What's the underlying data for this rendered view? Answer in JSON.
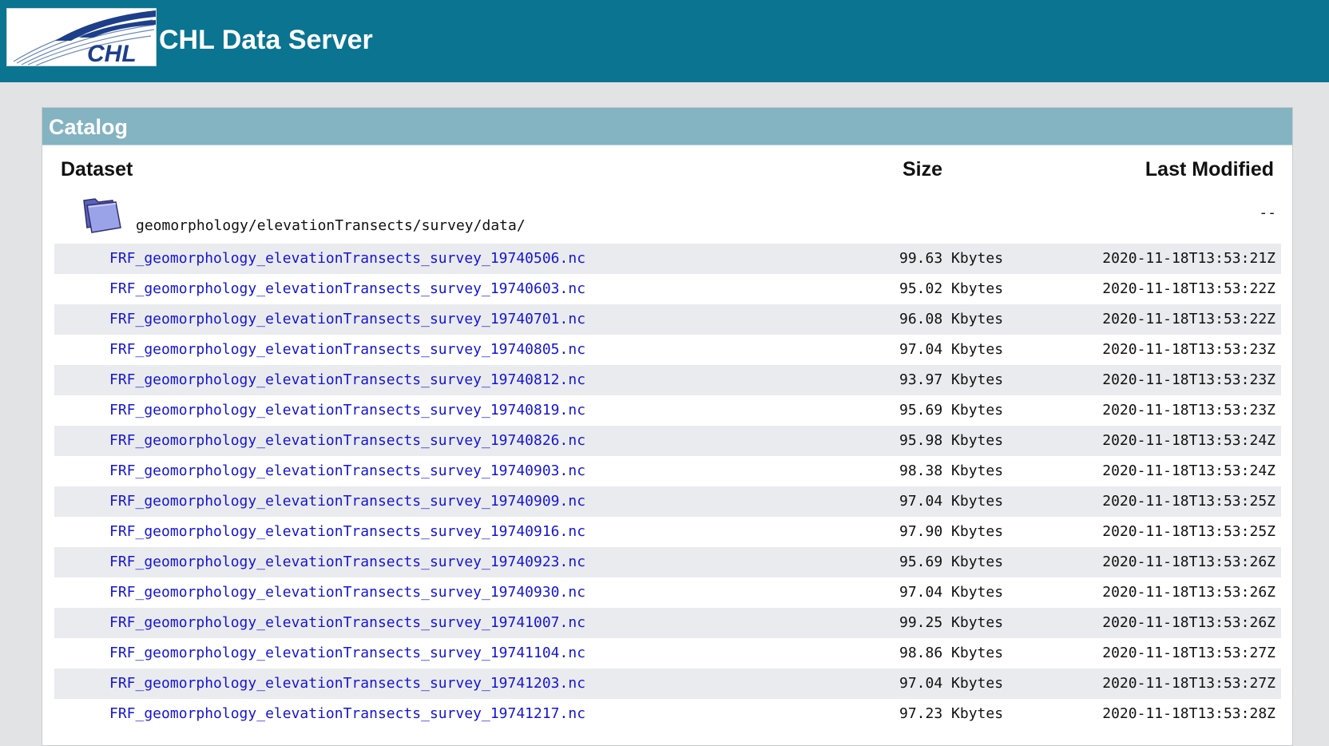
{
  "header": {
    "site_title": "CHL Data Server",
    "logo_text": "CHL",
    "background_color": "#0a7491"
  },
  "catalog": {
    "title": "Catalog",
    "header_color": "#84b3c1",
    "columns": {
      "dataset": "Dataset",
      "size": "Size",
      "last_modified": "Last Modified"
    },
    "folder": {
      "icon": "folder-icon",
      "path": "geomorphology/elevationTransects/survey/data/",
      "last_modified": "--"
    },
    "rows": [
      {
        "name": "FRF_geomorphology_elevationTransects_survey_19740506.nc",
        "size": "99.63 Kbytes",
        "modified": "2020-11-18T13:53:21Z"
      },
      {
        "name": "FRF_geomorphology_elevationTransects_survey_19740603.nc",
        "size": "95.02 Kbytes",
        "modified": "2020-11-18T13:53:22Z"
      },
      {
        "name": "FRF_geomorphology_elevationTransects_survey_19740701.nc",
        "size": "96.08 Kbytes",
        "modified": "2020-11-18T13:53:22Z"
      },
      {
        "name": "FRF_geomorphology_elevationTransects_survey_19740805.nc",
        "size": "97.04 Kbytes",
        "modified": "2020-11-18T13:53:23Z"
      },
      {
        "name": "FRF_geomorphology_elevationTransects_survey_19740812.nc",
        "size": "93.97 Kbytes",
        "modified": "2020-11-18T13:53:23Z"
      },
      {
        "name": "FRF_geomorphology_elevationTransects_survey_19740819.nc",
        "size": "95.69 Kbytes",
        "modified": "2020-11-18T13:53:23Z"
      },
      {
        "name": "FRF_geomorphology_elevationTransects_survey_19740826.nc",
        "size": "95.98 Kbytes",
        "modified": "2020-11-18T13:53:24Z"
      },
      {
        "name": "FRF_geomorphology_elevationTransects_survey_19740903.nc",
        "size": "98.38 Kbytes",
        "modified": "2020-11-18T13:53:24Z"
      },
      {
        "name": "FRF_geomorphology_elevationTransects_survey_19740909.nc",
        "size": "97.04 Kbytes",
        "modified": "2020-11-18T13:53:25Z"
      },
      {
        "name": "FRF_geomorphology_elevationTransects_survey_19740916.nc",
        "size": "97.90 Kbytes",
        "modified": "2020-11-18T13:53:25Z"
      },
      {
        "name": "FRF_geomorphology_elevationTransects_survey_19740923.nc",
        "size": "95.69 Kbytes",
        "modified": "2020-11-18T13:53:26Z"
      },
      {
        "name": "FRF_geomorphology_elevationTransects_survey_19740930.nc",
        "size": "97.04 Kbytes",
        "modified": "2020-11-18T13:53:26Z"
      },
      {
        "name": "FRF_geomorphology_elevationTransects_survey_19741007.nc",
        "size": "99.25 Kbytes",
        "modified": "2020-11-18T13:53:26Z"
      },
      {
        "name": "FRF_geomorphology_elevationTransects_survey_19741104.nc",
        "size": "98.86 Kbytes",
        "modified": "2020-11-18T13:53:27Z"
      },
      {
        "name": "FRF_geomorphology_elevationTransects_survey_19741203.nc",
        "size": "97.04 Kbytes",
        "modified": "2020-11-18T13:53:27Z"
      },
      {
        "name": "FRF_geomorphology_elevationTransects_survey_19741217.nc",
        "size": "97.23 Kbytes",
        "modified": "2020-11-18T13:53:28Z"
      }
    ]
  }
}
